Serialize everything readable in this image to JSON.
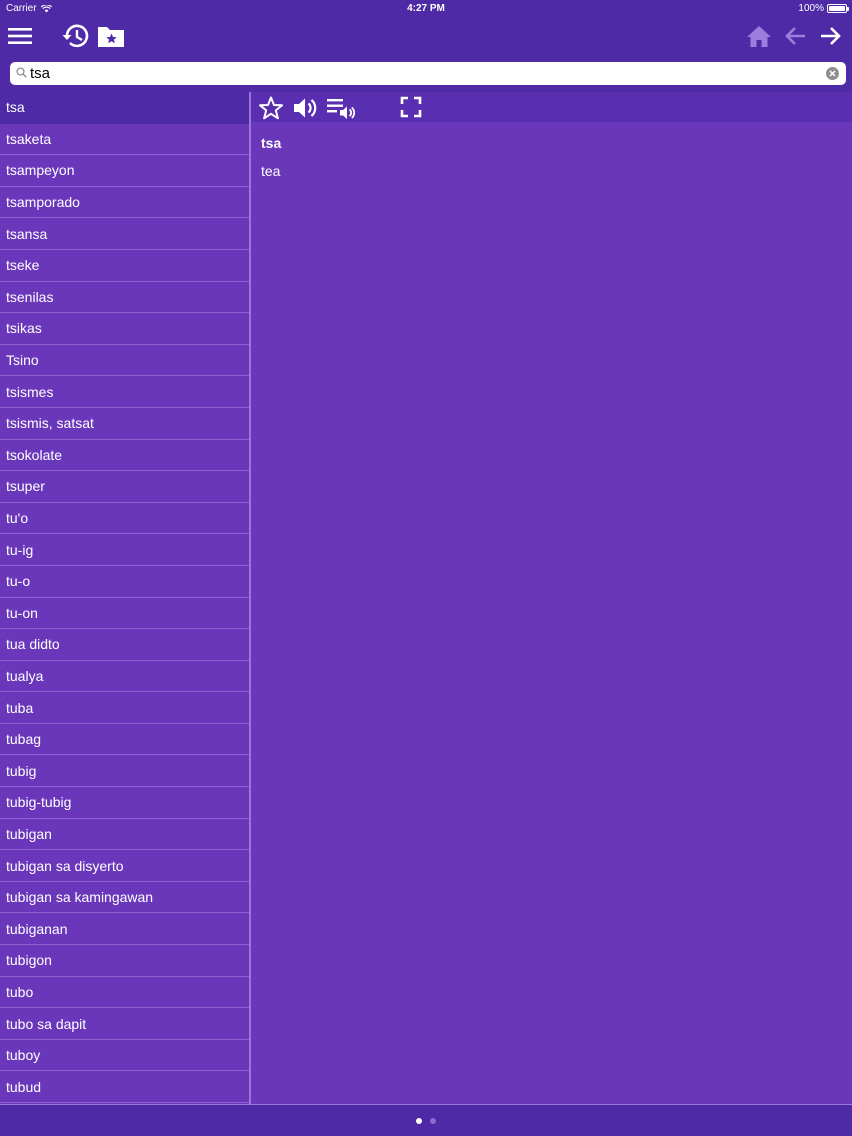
{
  "status_bar": {
    "carrier": "Carrier",
    "time": "4:27 PM",
    "battery": "100%"
  },
  "toolbar": {
    "menu_icon": "hamburger-icon",
    "history_icon": "history-clock-icon",
    "favorites_icon": "folder-star-icon",
    "home_icon": "home-icon",
    "back_icon": "arrow-left-icon",
    "forward_icon": "arrow-right-icon"
  },
  "search": {
    "value": "tsa",
    "placeholder": ""
  },
  "word_list": [
    "tsa",
    "tsaketa",
    "tsampeyon",
    "tsamporado",
    "tsansa",
    "tseke",
    "tsenilas",
    "tsikas",
    "Tsino",
    "tsismes",
    "tsismis, satsat",
    "tsokolate",
    "tsuper",
    "tu'o",
    "tu-ig",
    "tu-o",
    "tu-on",
    "tua didto",
    "tualya",
    "tuba",
    "tubag",
    "tubig",
    "tubig-tubig",
    "tubigan",
    "tubigan sa disyerto",
    "tubigan sa kamingawan",
    "tubiganan",
    "tubigon",
    "tubo",
    "tubo sa dapit",
    "tuboy",
    "tubud"
  ],
  "selected_index": 0,
  "detail": {
    "headword": "tsa",
    "meaning": "tea",
    "tools": [
      "star-icon",
      "speaker-icon",
      "playlist-audio-icon",
      "fullscreen-icon"
    ]
  },
  "pager": {
    "pages": 2,
    "current": 1
  },
  "colors": {
    "bar": "#4f2aa6",
    "background": "#6a37bb",
    "selected": "#4f2aa6"
  }
}
